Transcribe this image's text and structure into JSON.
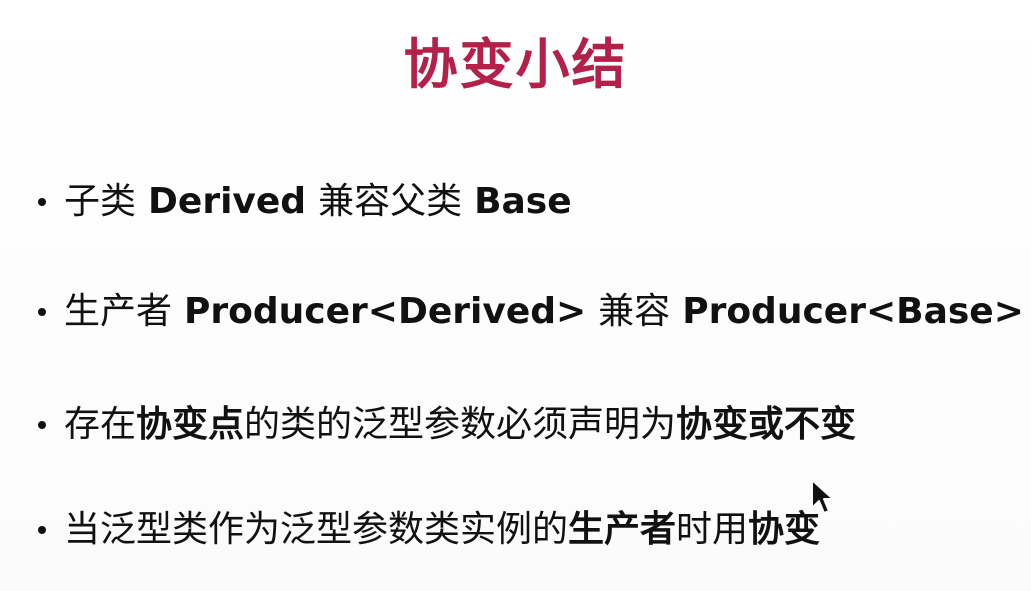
{
  "slide": {
    "title": "协变小结",
    "title_color": "#b3204a",
    "bullets": [
      {
        "parts": [
          "子类",
          "Derived",
          "兼容父类",
          "Base"
        ]
      },
      {
        "parts": [
          "生产者",
          "Producer<Derived>",
          "兼容",
          "Producer<Base>"
        ]
      },
      {
        "parts": [
          "存在",
          "协变点",
          "的类的泛型参数必须声明为",
          "协变或不变"
        ]
      },
      {
        "parts": [
          "当泛型类作为泛型参数类实例的",
          "生产者",
          "时用",
          "协变"
        ]
      }
    ]
  },
  "icons": {
    "bullet": "bullet-dot-icon",
    "pointer": "mouse-pointer-icon"
  }
}
